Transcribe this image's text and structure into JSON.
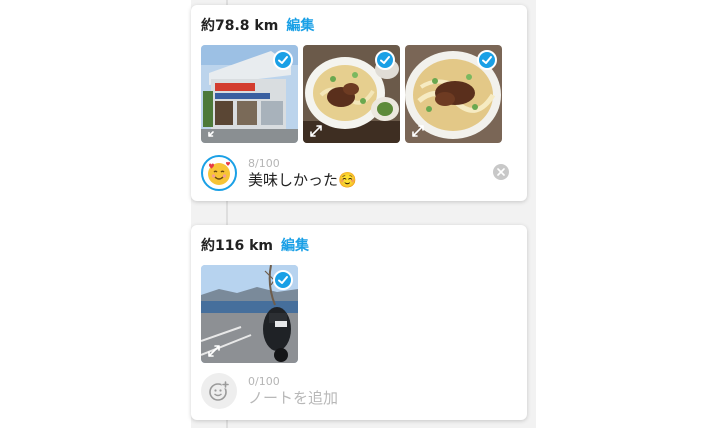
{
  "entries": [
    {
      "distance": "約78.8 km",
      "edit_label": "編集",
      "photos": [
        {
          "subject": "restaurant storefront"
        },
        {
          "subject": "ramen bowl"
        },
        {
          "subject": "ramen bowl close-up"
        }
      ],
      "note": {
        "counter": "8/100",
        "text": "美味しかった☺️",
        "avatar_icon": "smiling-face-hearts-icon"
      }
    },
    {
      "distance": "約116 km",
      "edit_label": "編集",
      "photos": [
        {
          "subject": "motorcycle by the lake"
        }
      ],
      "note": {
        "counter": "0/100",
        "placeholder": "ノートを追加",
        "avatar_icon": "add-emoji-icon"
      }
    }
  ],
  "colors": {
    "accent": "#1aa0e6",
    "check": "#1aa0e6",
    "text": "#222222",
    "muted": "#b5b5b5",
    "rail_background": "#f2f2f2"
  }
}
